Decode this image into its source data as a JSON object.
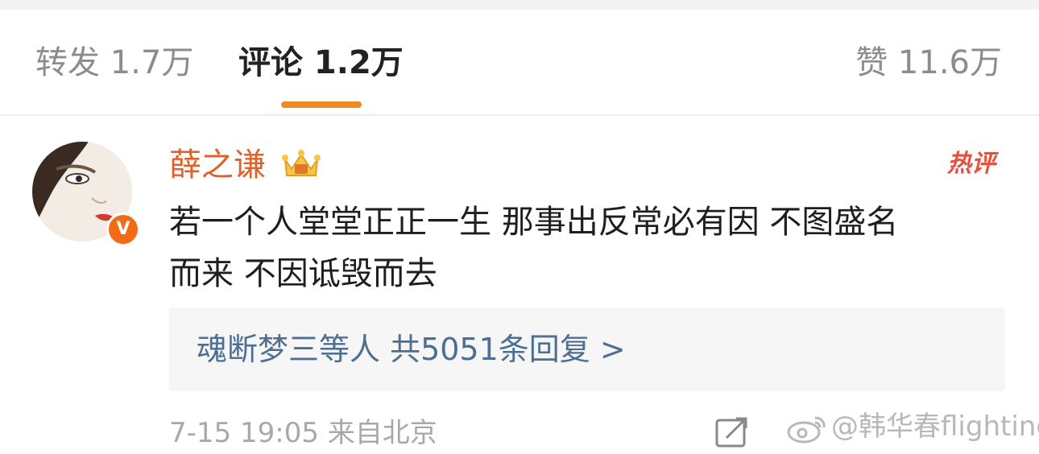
{
  "tabs": {
    "repost": "转发 1.7万",
    "comment": "评论 1.2万",
    "like": "赞 11.6万"
  },
  "comment": {
    "avatar_icon": "avatar-portrait",
    "verified_icon": "verified-v-icon",
    "verified_mark": "V",
    "username": "薛之谦",
    "badge_icon": "crown-vip-icon",
    "hot_badge": "热评",
    "text_line1": "若一个人堂堂正正一生 那事出反常必有因 不图盛名",
    "text_line2": "而来 不因诋毁而去",
    "replies": {
      "label": "魂断梦三等人 共5051条回复 >"
    },
    "time_location": "7-15 19:05 来自北京",
    "action_icon": "share-edit-icon"
  },
  "watermark": {
    "logo_icon": "weibo-logo-icon",
    "text": "@韩华春flighting"
  },
  "colors": {
    "accent": "#f08a24",
    "username": "#e0622a",
    "reply_link": "#4e6f94",
    "hot": "#e6503c"
  }
}
